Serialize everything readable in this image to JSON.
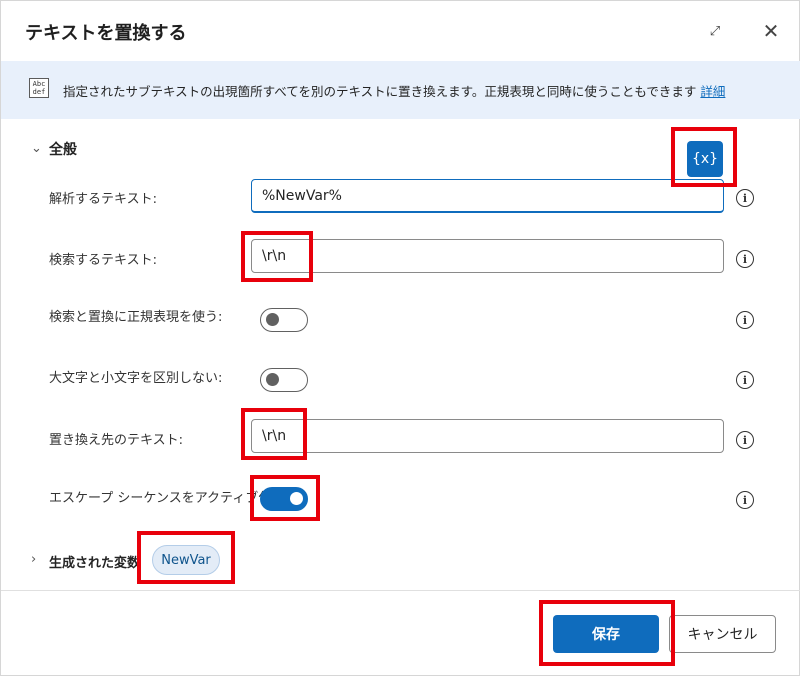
{
  "dialog": {
    "title": "テキストを置換する"
  },
  "banner": {
    "icon_text": "Abc def",
    "description": "指定されたサブテキストの出現箇所すべてを別のテキストに置き換えます。正規表現と同時に使うこともできます",
    "link_label": "詳細"
  },
  "general": {
    "section_title": "全般",
    "variable_button_label": "{x}",
    "fields": {
      "parse_text": {
        "label": "解析するテキスト:",
        "value": "%NewVar%"
      },
      "search_text": {
        "label": "検索するテキスト:",
        "value": "\\r\\n"
      },
      "use_regex": {
        "label": "検索と置換に正規表現を使う:",
        "on": false
      },
      "ignore_case": {
        "label": "大文字と小文字を区別しない:",
        "on": false
      },
      "replace_text": {
        "label": "置き換え先のテキスト:",
        "value": "\\r\\n"
      },
      "escape_sequences": {
        "label": "エスケープ シーケンスをアクティブ化:",
        "on": true
      }
    }
  },
  "generated": {
    "section_title": "生成された変数",
    "variable": "NewVar"
  },
  "footer": {
    "save_label": "保存",
    "cancel_label": "キャンセル"
  },
  "colors": {
    "accent": "#0f6cbd",
    "highlight": "#e8000b",
    "banner_bg": "#e8f0fb"
  }
}
